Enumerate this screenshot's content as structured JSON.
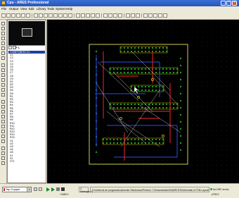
{
  "window": {
    "title": "Cpu - ARES Professional",
    "minimize_glyph": "_",
    "maximize_glyph": "□",
    "close_glyph": "×"
  },
  "menu": {
    "items": [
      "File",
      "Output",
      "View",
      "Edit",
      "Library",
      "Tools",
      "System",
      "Help"
    ]
  },
  "selector": {
    "mode_label": "P L",
    "items": [
      "COMPONENT-01",
      "C1",
      "C2",
      "C3",
      "C4",
      "C5",
      "C6",
      "C7",
      "C8",
      "C9",
      "D1",
      "D2",
      "D3",
      "D4",
      "D5",
      "R1",
      "R2",
      "R3",
      "R4",
      "R5",
      "R6",
      "R7",
      "R8",
      "R9",
      "R10",
      "R11",
      "R12",
      "R13",
      "R14",
      "R15",
      "U1",
      "U2",
      "U3",
      "U4",
      "U5",
      "X1",
      "X2",
      "VT1"
    ],
    "selected_index": 0
  },
  "status": {
    "layer": "Top Copper",
    "message_count": "4 Message(s)",
    "path": "D:\\Archivos de programa\\Labcenter Electronics\\Proteus 7 Demonstration\\SAMPLES\\Schematic & PCB Layout\\Cpu.LYT",
    "drc": "No DRC errors",
    "coord_x": "-4750.0",
    "coord_y": "+1650.0"
  },
  "colors": {
    "canvas_bg": "#000000",
    "board_outline": "#ffff66",
    "top_copper": "#cc2020",
    "bottom_copper": "#2040c0",
    "pads": "#20a020",
    "ratsnest": "#e8e8e8",
    "silk": "#ffff00"
  },
  "icons": {
    "app": "ares-app-icon",
    "play": "play-icon",
    "stop": "stop-icon"
  }
}
